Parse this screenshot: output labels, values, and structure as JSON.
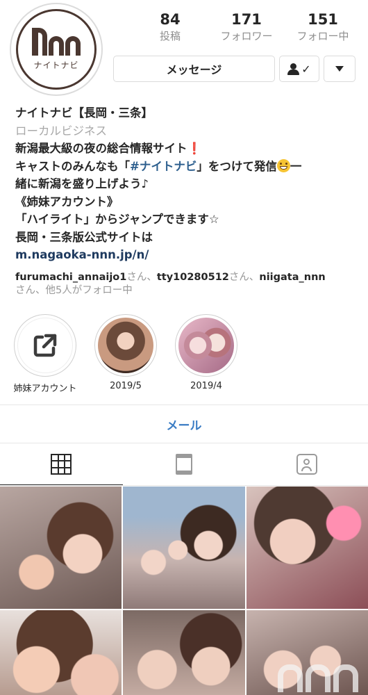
{
  "profile": {
    "logo_sub": "ナイトナビ",
    "stats": [
      {
        "value": "84",
        "label": "投稿"
      },
      {
        "value": "171",
        "label": "フォロワー"
      },
      {
        "value": "151",
        "label": "フォロー中"
      }
    ],
    "message_button": "メッセージ",
    "follow_check": "✓"
  },
  "bio": {
    "name": "ナイトナビ【長岡・三条】",
    "category": "ローカルビジネス",
    "line1": "新潟最大級の夜の総合情報サイト",
    "line1_mark": "❗",
    "line2_pre": "キャストのみんなも「",
    "line2_hashtag": "#ナイトナビ",
    "line2_post": "」をつけて発信",
    "line2_end": "一",
    "line3": "緒に新潟を盛り上げよう♪",
    "line4": "《姉妹アカウント》",
    "line5": "「ハイライト」からジャンプできます☆",
    "line6": "長岡・三条版公式サイトは",
    "link": "m.nagaoka-nnn.jp/n/"
  },
  "followed_by": {
    "user1": "furumachi_annaijo1",
    "sep1": "さん、",
    "user2": "tty10280512",
    "sep2": "さん、",
    "user3": "niigata_nnn",
    "rest": "さん、他5人がフォロー中"
  },
  "highlights": [
    {
      "label": "姉妹アカウント",
      "icon": "external-link-icon"
    },
    {
      "label": "2019/5"
    },
    {
      "label": "2019/4"
    }
  ],
  "email_button": "メール",
  "tabs": [
    {
      "icon": "grid-icon",
      "active": true
    },
    {
      "icon": "feed-icon",
      "active": false
    },
    {
      "icon": "tagged-icon",
      "active": false
    }
  ]
}
